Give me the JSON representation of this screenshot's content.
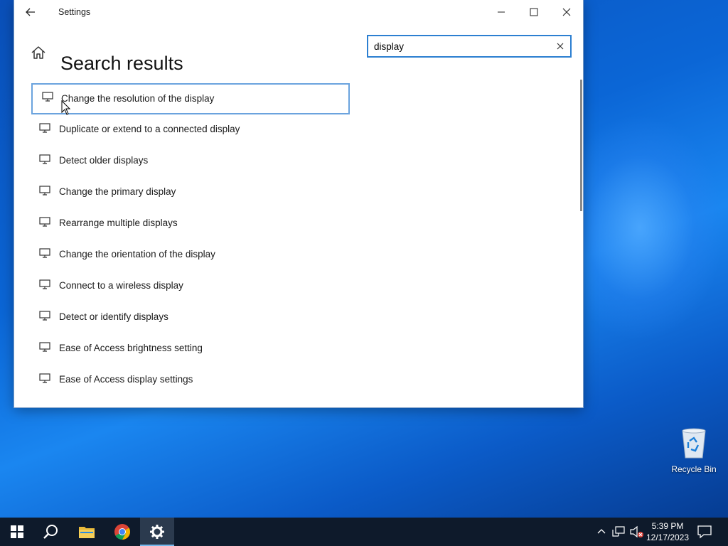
{
  "window": {
    "title": "Settings",
    "page_title": "Search results"
  },
  "search": {
    "value": "display"
  },
  "results": [
    {
      "label": "Change the resolution of the display",
      "selected": true
    },
    {
      "label": "Duplicate or extend to a connected display"
    },
    {
      "label": "Detect older displays"
    },
    {
      "label": "Change the primary display"
    },
    {
      "label": "Rearrange multiple displays"
    },
    {
      "label": "Change the orientation of the display"
    },
    {
      "label": "Connect to a wireless display"
    },
    {
      "label": "Detect or identify displays"
    },
    {
      "label": "Ease of Access brightness setting"
    },
    {
      "label": "Ease of Access display settings"
    }
  ],
  "desktop": {
    "recycle_bin_label": "Recycle Bin"
  },
  "taskbar": {
    "time": "5:39 PM",
    "date": "12/17/2023",
    "items": [
      "start-icon",
      "search-icon",
      "file-explorer-icon",
      "chrome-icon",
      "settings-icon"
    ]
  },
  "colors": {
    "accent": "#2c7fd1",
    "selected_border": "#6ba3de",
    "taskbar": "#0e1a2b"
  }
}
